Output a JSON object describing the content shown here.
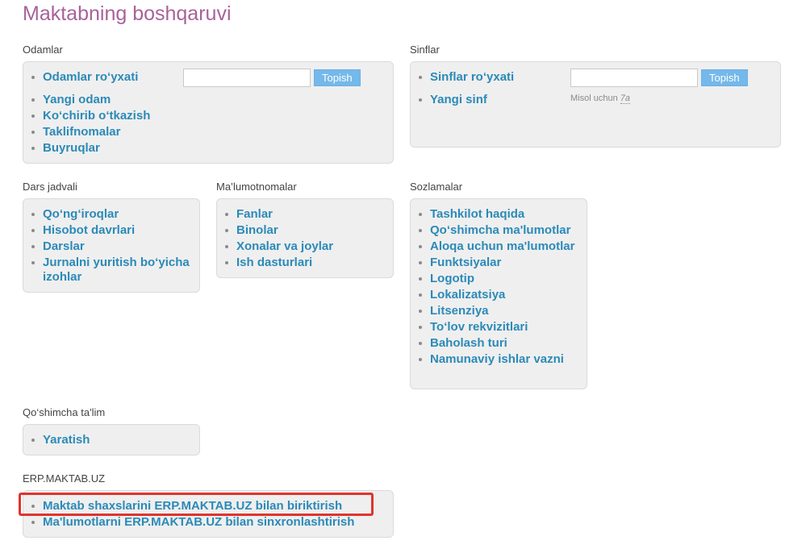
{
  "page_title": "Maktabning boshqaruvi",
  "people": {
    "label": "Odamlar",
    "items": [
      "Odamlar ro‘yxati",
      "Yangi odam",
      "Ko‘chirib o‘tkazish",
      "Taklifnomalar",
      "Buyruqlar"
    ],
    "search_value": "",
    "search_button": "Topish"
  },
  "classes": {
    "label": "Sinflar",
    "items": [
      "Sinflar ro‘yxati",
      "Yangi sinf"
    ],
    "search_value": "",
    "search_button": "Topish",
    "hint_prefix": "Misol uchun",
    "hint_example": "7a"
  },
  "schedule": {
    "label": "Dars jadvali",
    "items": [
      "Qo‘ng‘iroqlar",
      "Hisobot davrlari",
      "Darslar",
      "Jurnalni yuritish bo‘yicha izohlar"
    ]
  },
  "references": {
    "label": "Ma’lumotnomalar",
    "items": [
      "Fanlar",
      "Binolar",
      "Xonalar va joylar",
      "Ish dasturlari"
    ]
  },
  "settings": {
    "label": "Sozlamalar",
    "items": [
      "Tashkilot haqida",
      "Qo‘shimcha ma'lumotlar",
      "Aloqa uchun ma'lumotlar",
      "Funktsiyalar",
      "Logotip",
      "Lokalizatsiya",
      "Litsenziya",
      "To‘lov rekvizitlari",
      "Baholash turi",
      "Namunaviy ishlar vazni"
    ]
  },
  "extra_education": {
    "label": "Qo‘shimcha ta'lim",
    "items": [
      "Yaratish"
    ]
  },
  "erp": {
    "label": "ERP.MAKTAB.UZ",
    "items": [
      "Maktab shaxslarini ERP.MAKTAB.UZ bilan biriktirish",
      "Ma'lumotlarni ERP.MAKTAB.UZ bilan sinxronlashtirish"
    ]
  },
  "colors": {
    "title": "#a86299",
    "link": "#2b8ab8",
    "button": "#75b8ea",
    "highlight": "#e0342e"
  }
}
